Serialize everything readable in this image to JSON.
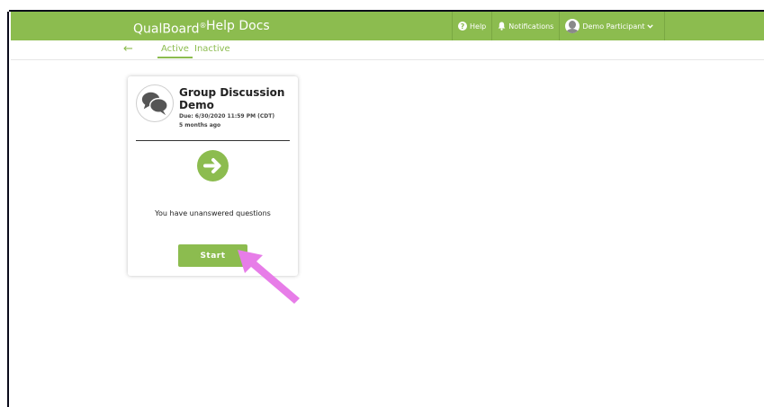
{
  "navbar": {
    "brand": "QualBoard",
    "brand_mark": "®",
    "help_docs": "Help Docs",
    "help": "Help",
    "notifications": "Notifications",
    "user": "Demo Participant"
  },
  "subnav": {
    "back_icon": "arrow-left-icon",
    "tabs": [
      {
        "label": "Active"
      },
      {
        "label": "Inactive"
      }
    ]
  },
  "card": {
    "title": "Group Discussion Demo",
    "due": "Due: 6/30/2020 11:59 PM (CDT)",
    "ago": "5 months ago",
    "status": "You have unanswered questions",
    "start_label": "Start"
  },
  "colors": {
    "brand_green": "#8cbc4f",
    "annotation_pink": "#e77de8"
  }
}
